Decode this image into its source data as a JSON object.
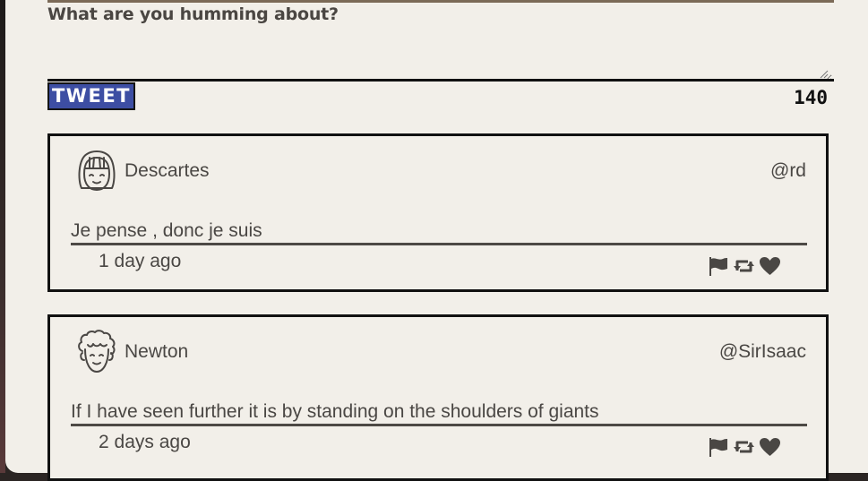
{
  "composer": {
    "prompt_label": "What are you humming about?",
    "textarea_value": "",
    "tweet_button_label": "TWEET",
    "char_count": "140"
  },
  "tweets": [
    {
      "author": "Descartes",
      "handle": "@rd",
      "avatar_icon": "girl-face-icon",
      "text": "Je pense , donc je suis",
      "timestamp": "1 day ago"
    },
    {
      "author": "Newton",
      "handle": "@SirIsaac",
      "avatar_icon": "curly-hair-face-icon",
      "text": "If I have seen further it is by standing on the shoulders of giants",
      "timestamp": "2 days ago"
    }
  ],
  "action_icons": [
    "flag-icon",
    "retweet-icon",
    "heart-icon"
  ],
  "colors": {
    "panel_bg": "#f2efe9",
    "tweet_button_bg": "#3d4ea3",
    "text": "#4a4744",
    "border": "#111111"
  }
}
